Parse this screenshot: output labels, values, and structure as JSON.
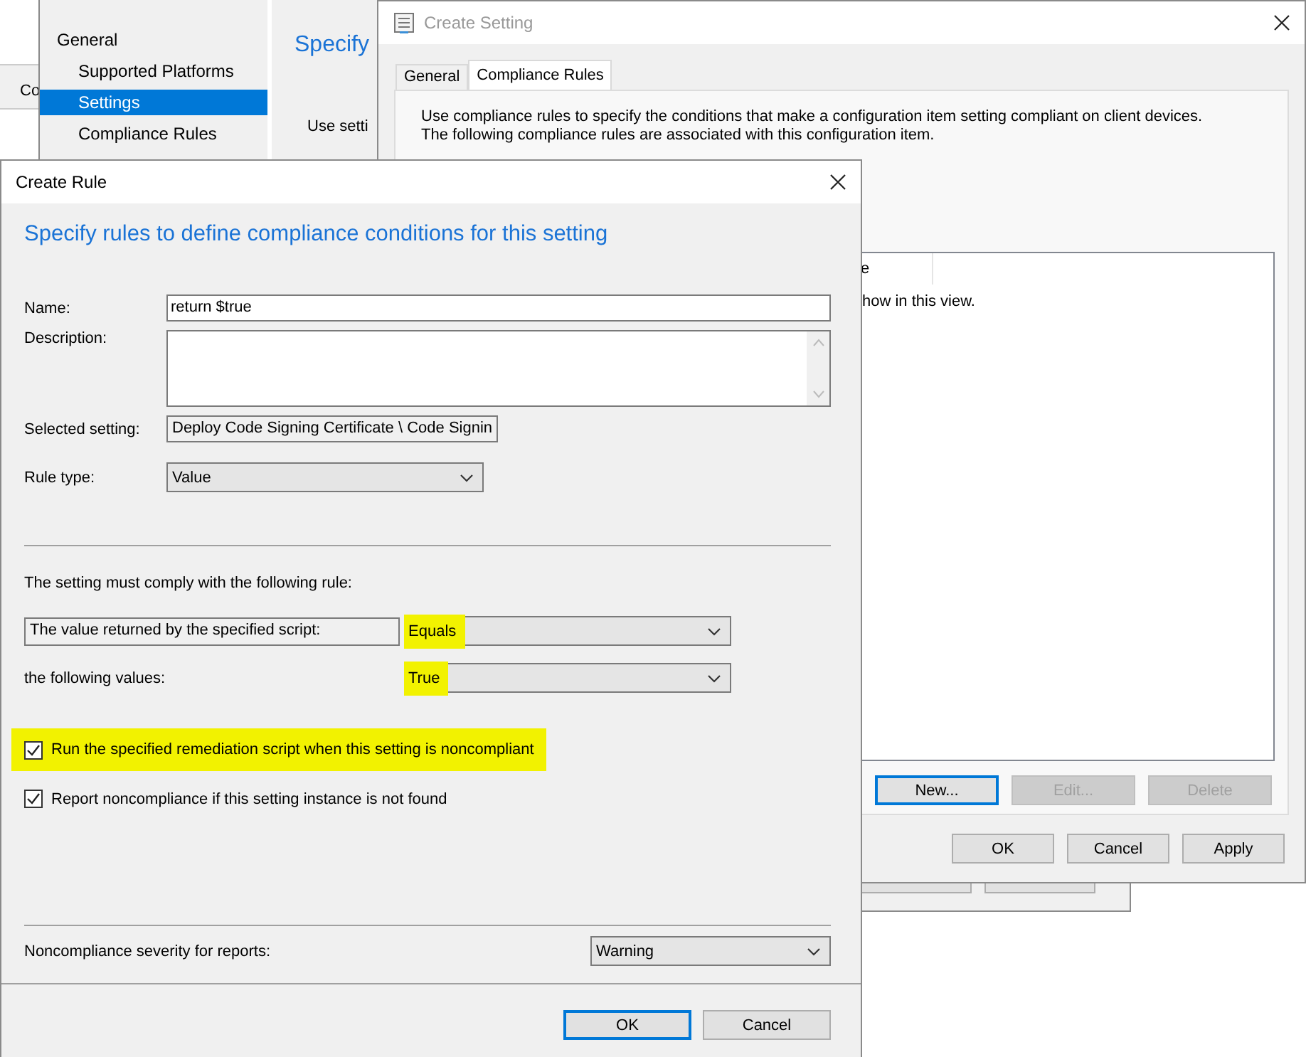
{
  "background_app": {
    "tab_label": "Co"
  },
  "wizard": {
    "nav": [
      {
        "label": "General",
        "selected": false,
        "children": [
          {
            "label": "Supported Platforms",
            "selected": false
          },
          {
            "label": "Settings",
            "selected": true
          },
          {
            "label": "Compliance Rules",
            "selected": false
          }
        ]
      }
    ],
    "heading": "Specify",
    "intro": "Use setti"
  },
  "create_setting": {
    "title": "Create Setting",
    "tabs": [
      {
        "label": "General",
        "selected": false
      },
      {
        "label": "Compliance Rules",
        "selected": true
      }
    ],
    "description": "Use compliance rules to specify the conditions that make a configuration item setting compliant on client devices. The following compliance rules are associated with this configuration item.",
    "list": {
      "columns": [
        "e"
      ],
      "empty_text": "how in this view."
    },
    "list_buttons": [
      {
        "label": "New...",
        "disabled": false,
        "default": true
      },
      {
        "label": "Edit...",
        "disabled": true,
        "default": false
      },
      {
        "label": "Delete",
        "disabled": true,
        "default": false
      }
    ],
    "buttons": [
      {
        "label": "OK",
        "default": false
      },
      {
        "label": "Cancel",
        "default": false
      },
      {
        "label": "Apply",
        "default": false
      }
    ]
  },
  "create_rule": {
    "title": "Create Rule",
    "heading": "Specify rules to define compliance conditions for this setting",
    "name": {
      "label": "Name:",
      "value": "return $true"
    },
    "description": {
      "label": "Description:"
    },
    "selected_setting": {
      "label": "Selected setting:",
      "value": "Deploy Code Signing Certificate \\ Code Signin"
    },
    "rule_type": {
      "label": "Rule type:",
      "value": "Value"
    },
    "rule_intro": "The setting must comply with the following rule:",
    "rule_source": "The value returned by the specified script:",
    "operator": {
      "value": "Equals",
      "highlighted": true
    },
    "values_label": "the following values:",
    "value": {
      "value": "True",
      "highlighted": true
    },
    "checkboxes": [
      {
        "label": "Run the specified remediation script when this setting is noncompliant",
        "checked": true,
        "highlighted": true
      },
      {
        "label": "Report noncompliance if this setting instance is not found",
        "checked": true,
        "highlighted": false
      }
    ],
    "severity": {
      "label": "Noncompliance severity for reports:",
      "value": "Warning"
    },
    "buttons": [
      {
        "label": "OK",
        "default": true
      },
      {
        "label": "Cancel",
        "default": false
      }
    ]
  }
}
